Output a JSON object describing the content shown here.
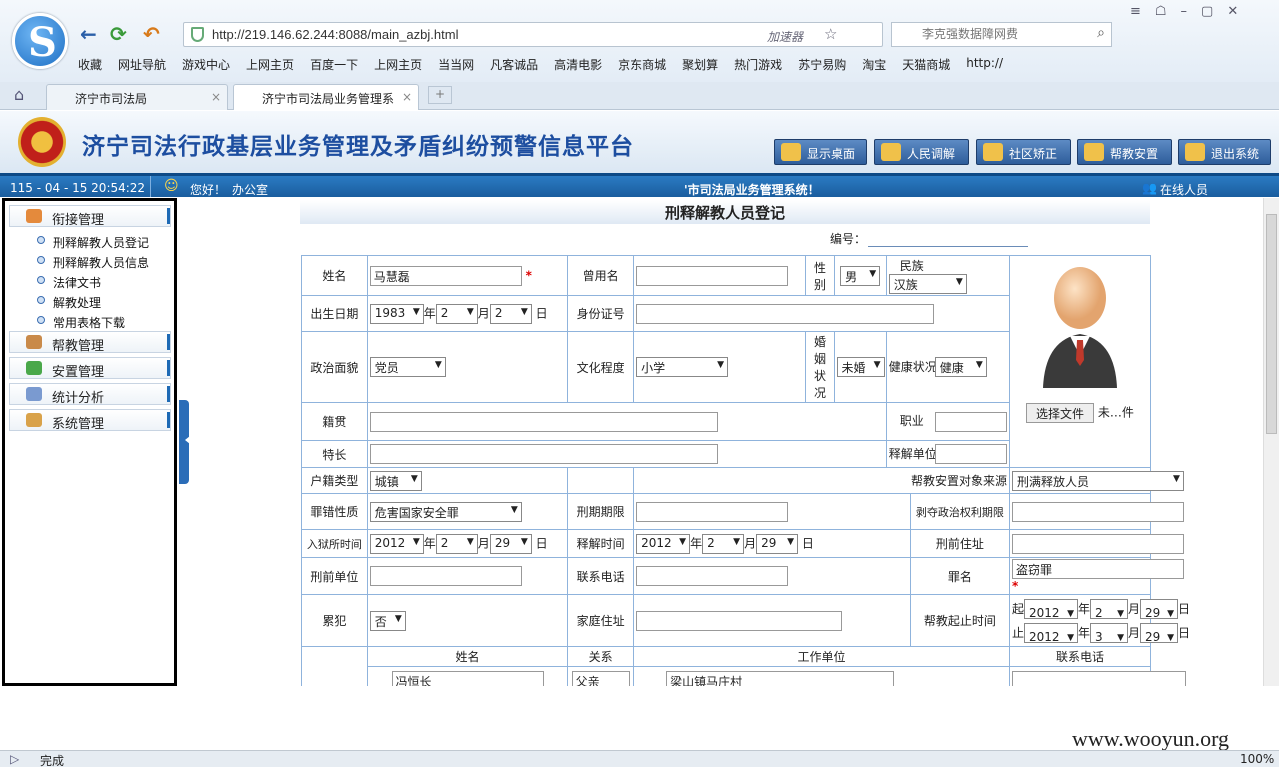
{
  "browser": {
    "url": "http://219.146.62.244:8088/main_azbj.html",
    "accelerator": "加速器",
    "search_placeholder": "李克强数据障网费",
    "bookmarks": [
      "收藏",
      "网址导航",
      "游戏中心",
      "上网主页",
      "百度一下",
      "上网主页",
      "当当网",
      "凡客诚品",
      "高清电影",
      "京东商城",
      "聚划算",
      "热门游戏",
      "苏宁易购",
      "淘宝",
      "天猫商城",
      "http://"
    ],
    "tabs": [
      "济宁市司法局",
      "济宁市司法局业务管理系"
    ]
  },
  "site": {
    "title": "济宁司法行政基层业务管理及矛盾纠纷预警信息平台",
    "buttons": [
      "显示桌面",
      "人民调解",
      "社区矫正",
      "帮教安置",
      "退出系统"
    ],
    "datetime": "115 - 04 - 15  20:54:22",
    "greeting": "您好！",
    "user": "办公室",
    "system_name": "'市司法局业务管理系统！",
    "online": "在线人员"
  },
  "sidebar": {
    "sections": [
      "衔接管理",
      "帮教管理",
      "安置管理",
      "统计分析",
      "系统管理"
    ],
    "sub_items": [
      "刑释解教人员登记",
      "刑释解教人员信息",
      "法律文书",
      "解教处理",
      "常用表格下载"
    ]
  },
  "form": {
    "title": "刑释解教人员登记",
    "no_label": "编号：",
    "labels": {
      "name": "姓名",
      "alias": "曾用名",
      "gender": "性别",
      "ethnic": "民族",
      "birth": "出生日期",
      "idcard": "身份证号",
      "political": "政治面貌",
      "education": "文化程度",
      "marital": "婚姻状况",
      "health": "健康状况",
      "native": "籍贯",
      "job": "职业",
      "specialty": "特长",
      "release_unit": "释解单位",
      "hukou": "户籍类型",
      "source": "帮教安置对象来源",
      "crime_type": "罪错性质",
      "term": "刑期期限",
      "deprive": "剥夺政治权利期限",
      "prison_time": "入狱所时间",
      "release_time": "释解时间",
      "prev_addr": "刑前住址",
      "prev_unit": "刑前单位",
      "phone": "联系电话",
      "crime": "罪名",
      "recid": "累犯",
      "home_addr": "家庭住址",
      "help_time": "帮教起止时间",
      "year": "年",
      "month": "月",
      "day": "日",
      "from": "起",
      "to": "止",
      "file_btn": "选择文件",
      "file_none": "未…件"
    },
    "values": {
      "name": "马慧磊",
      "gender": "男",
      "ethnic": "汉族",
      "birth_y": "1983",
      "birth_m": "2",
      "birth_d": "2",
      "political": "党员",
      "education": "小学",
      "marital": "未婚",
      "health": "健康",
      "hukou": "城镇",
      "source": "刑满释放人员",
      "crime_type": "危害国家安全罪",
      "prison_y": "2012",
      "prison_m": "2",
      "prison_d": "29",
      "release_y": "2012",
      "release_m": "2",
      "release_d": "29",
      "crime": "盗窃罪",
      "recid": "否",
      "help_from_y": "2012",
      "help_from_m": "2",
      "help_from_d": "29",
      "help_to_y": "2012",
      "help_to_m": "3",
      "help_to_d": "29"
    },
    "family": {
      "headers": [
        "姓名",
        "关系",
        "工作单位",
        "联系电话"
      ],
      "rows": [
        {
          "name": "冯恒长",
          "rel": "父亲",
          "unit": "梁山镇马庄村",
          "phone": ""
        }
      ]
    }
  },
  "statusbar": {
    "text": "完成",
    "zoom": "100%"
  },
  "watermark": "www.wooyun.org"
}
